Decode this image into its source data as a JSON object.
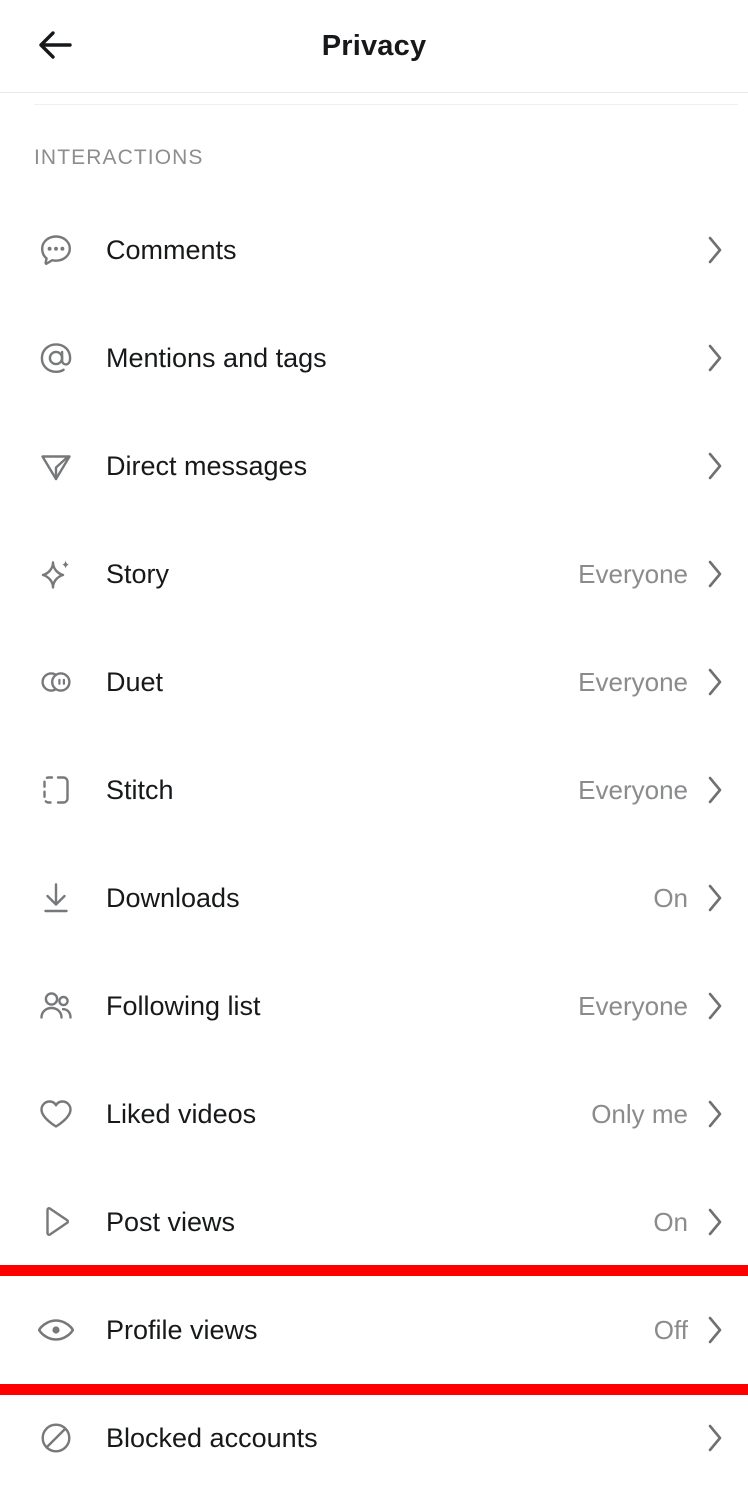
{
  "header": {
    "title": "Privacy",
    "back_icon": "arrow-left-icon"
  },
  "sections": [
    {
      "title": "INTERACTIONS",
      "items": [
        {
          "icon": "comment-bubble-icon",
          "label": "Comments",
          "value": "",
          "chevron": "chevron-right-icon",
          "highlighted": false
        },
        {
          "icon": "at-sign-icon",
          "label": "Mentions and tags",
          "value": "",
          "chevron": "chevron-right-icon",
          "highlighted": false
        },
        {
          "icon": "send-plane-icon",
          "label": "Direct messages",
          "value": "",
          "chevron": "chevron-right-icon",
          "highlighted": false
        },
        {
          "icon": "sparkle-icon",
          "label": "Story",
          "value": "Everyone",
          "chevron": "chevron-right-icon",
          "highlighted": false
        },
        {
          "icon": "duet-circles-icon",
          "label": "Duet",
          "value": "Everyone",
          "chevron": "chevron-right-icon",
          "highlighted": false
        },
        {
          "icon": "stitch-bracket-icon",
          "label": "Stitch",
          "value": "Everyone",
          "chevron": "chevron-right-icon",
          "highlighted": false
        },
        {
          "icon": "download-icon",
          "label": "Downloads",
          "value": "On",
          "chevron": "chevron-right-icon",
          "highlighted": false
        },
        {
          "icon": "people-icon",
          "label": "Following list",
          "value": "Everyone",
          "chevron": "chevron-right-icon",
          "highlighted": false
        },
        {
          "icon": "heart-icon",
          "label": "Liked videos",
          "value": "Only me",
          "chevron": "chevron-right-icon",
          "highlighted": false
        },
        {
          "icon": "play-triangle-icon",
          "label": "Post views",
          "value": "On",
          "chevron": "chevron-right-icon",
          "highlighted": false
        },
        {
          "icon": "eye-icon",
          "label": "Profile views",
          "value": "Off",
          "chevron": "chevron-right-icon",
          "highlighted": true
        },
        {
          "icon": "block-circle-icon",
          "label": "Blocked accounts",
          "value": "",
          "chevron": "chevron-right-icon",
          "highlighted": false
        }
      ]
    }
  ],
  "colors": {
    "highlight": "#ff0000",
    "label_text": "#16181a",
    "value_text": "#8a8b8d",
    "section_text": "#8c8d8f",
    "icon": "#77787a",
    "background": "#ffffff",
    "divider": "#e9e9ea"
  }
}
